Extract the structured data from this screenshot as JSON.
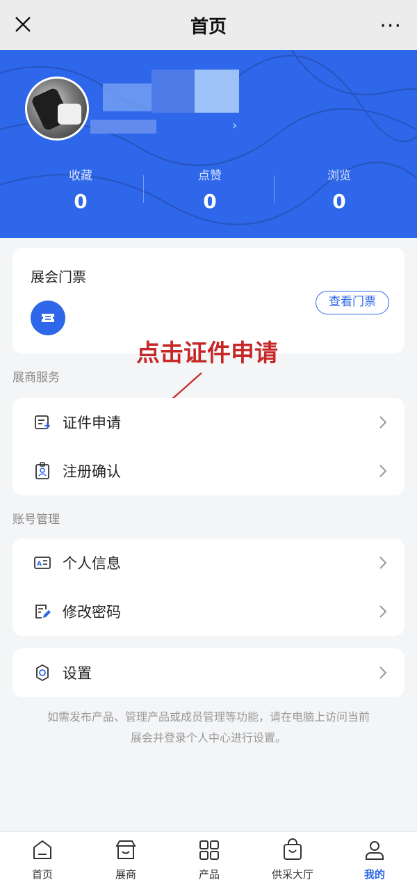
{
  "topbar": {
    "title": "首页",
    "more": "···"
  },
  "profile": {
    "stats": [
      {
        "label": "收藏",
        "value": "0"
      },
      {
        "label": "点赞",
        "value": "0"
      },
      {
        "label": "浏览",
        "value": "0"
      }
    ]
  },
  "ticket": {
    "title": "展会门票",
    "button": "查看门票"
  },
  "annotation": "点击证件申请",
  "sections": {
    "exhibitor": {
      "label": "展商服务",
      "items": [
        {
          "label": "证件申请",
          "icon": "certificate-icon"
        },
        {
          "label": "注册确认",
          "icon": "badge-icon"
        }
      ]
    },
    "account": {
      "label": "账号管理",
      "items": [
        {
          "label": "个人信息",
          "icon": "id-card-icon"
        },
        {
          "label": "修改密码",
          "icon": "edit-doc-icon"
        }
      ]
    },
    "settings": {
      "items": [
        {
          "label": "设置",
          "icon": "gear-icon"
        }
      ]
    }
  },
  "note": {
    "line1": "如需发布产品、管理产品或成员管理等功能，请在电脑上访问当前",
    "line2": "展会并登录个人中心进行设置。"
  },
  "tabs": [
    {
      "label": "首页",
      "icon": "home-icon"
    },
    {
      "label": "展商",
      "icon": "store-icon"
    },
    {
      "label": "产品",
      "icon": "grid-icon"
    },
    {
      "label": "供采大厅",
      "icon": "bag-icon"
    },
    {
      "label": "我的",
      "icon": "user-icon",
      "active": true
    }
  ],
  "colors": {
    "primary": "#2f67ea",
    "annotation": "#c62828",
    "background": "#f4f5f7"
  }
}
